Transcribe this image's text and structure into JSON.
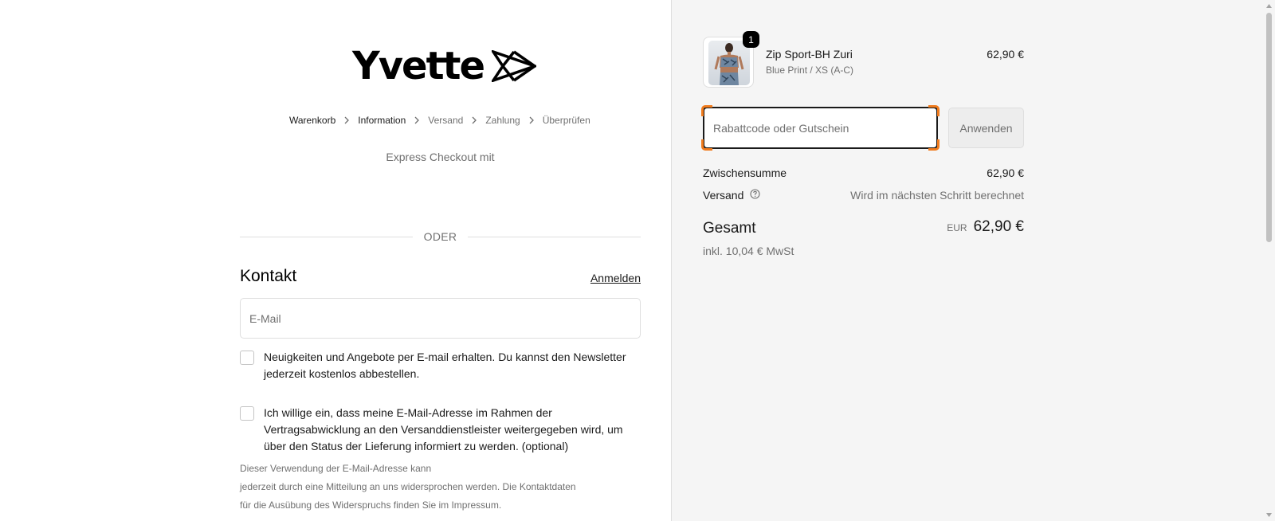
{
  "brand": {
    "logo_text": "Yvette"
  },
  "breadcrumb": [
    {
      "label": "Warenkorb",
      "active": true
    },
    {
      "label": "Information",
      "active": true
    },
    {
      "label": "Versand",
      "active": false
    },
    {
      "label": "Zahlung",
      "active": false
    },
    {
      "label": "Überprüfen",
      "active": false
    }
  ],
  "express": {
    "label": "Express Checkout mit"
  },
  "divider": {
    "label": "ODER"
  },
  "contact": {
    "title": "Kontakt",
    "login_link": "Anmelden",
    "email_placeholder": "E-Mail",
    "newsletter_label": "Neuigkeiten und Angebote per E-mail erhalten. Du kannst den Newsletter jederzeit kostenlos abbestellen.",
    "consent_label": "Ich willige ein, dass meine E-Mail-Adresse im Rahmen der Vertragsabwicklung an den Versanddienstleister weitergegeben wird, um über den Status der Lieferung informiert zu werden. (optional)",
    "notice": {
      "line1": "Dieser Verwendung der E-Mail-Adresse kann",
      "line2": "jederzeit durch eine Mitteilung an uns widersprochen werden. Die Kontaktdaten",
      "line3": "für die Ausübung des Widerspruchs finden Sie im Impressum."
    }
  },
  "cart": {
    "item": {
      "name": "Zip Sport-BH Zuri",
      "variant": "Blue Print / XS (A-C)",
      "price": "62,90 €",
      "quantity": "1",
      "image_icon": "product-photo"
    },
    "discount": {
      "placeholder": "Rabattcode oder Gutschein",
      "apply_label": "Anwenden"
    },
    "subtotal": {
      "label": "Zwischensumme",
      "value": "62,90 €"
    },
    "shipping": {
      "label": "Versand",
      "value": "Wird im nächsten Schritt berechnet",
      "help_icon": "question-circle-icon"
    },
    "total": {
      "label": "Gesamt",
      "currency": "EUR",
      "value": "62,90 €",
      "tax_note": "inkl. 10,04 € MwSt"
    }
  },
  "colors": {
    "accent": "#f07b1d",
    "text": "#1a1a1a",
    "muted": "#707070",
    "summary_bg": "#f5f5f5",
    "border": "#dedede"
  }
}
